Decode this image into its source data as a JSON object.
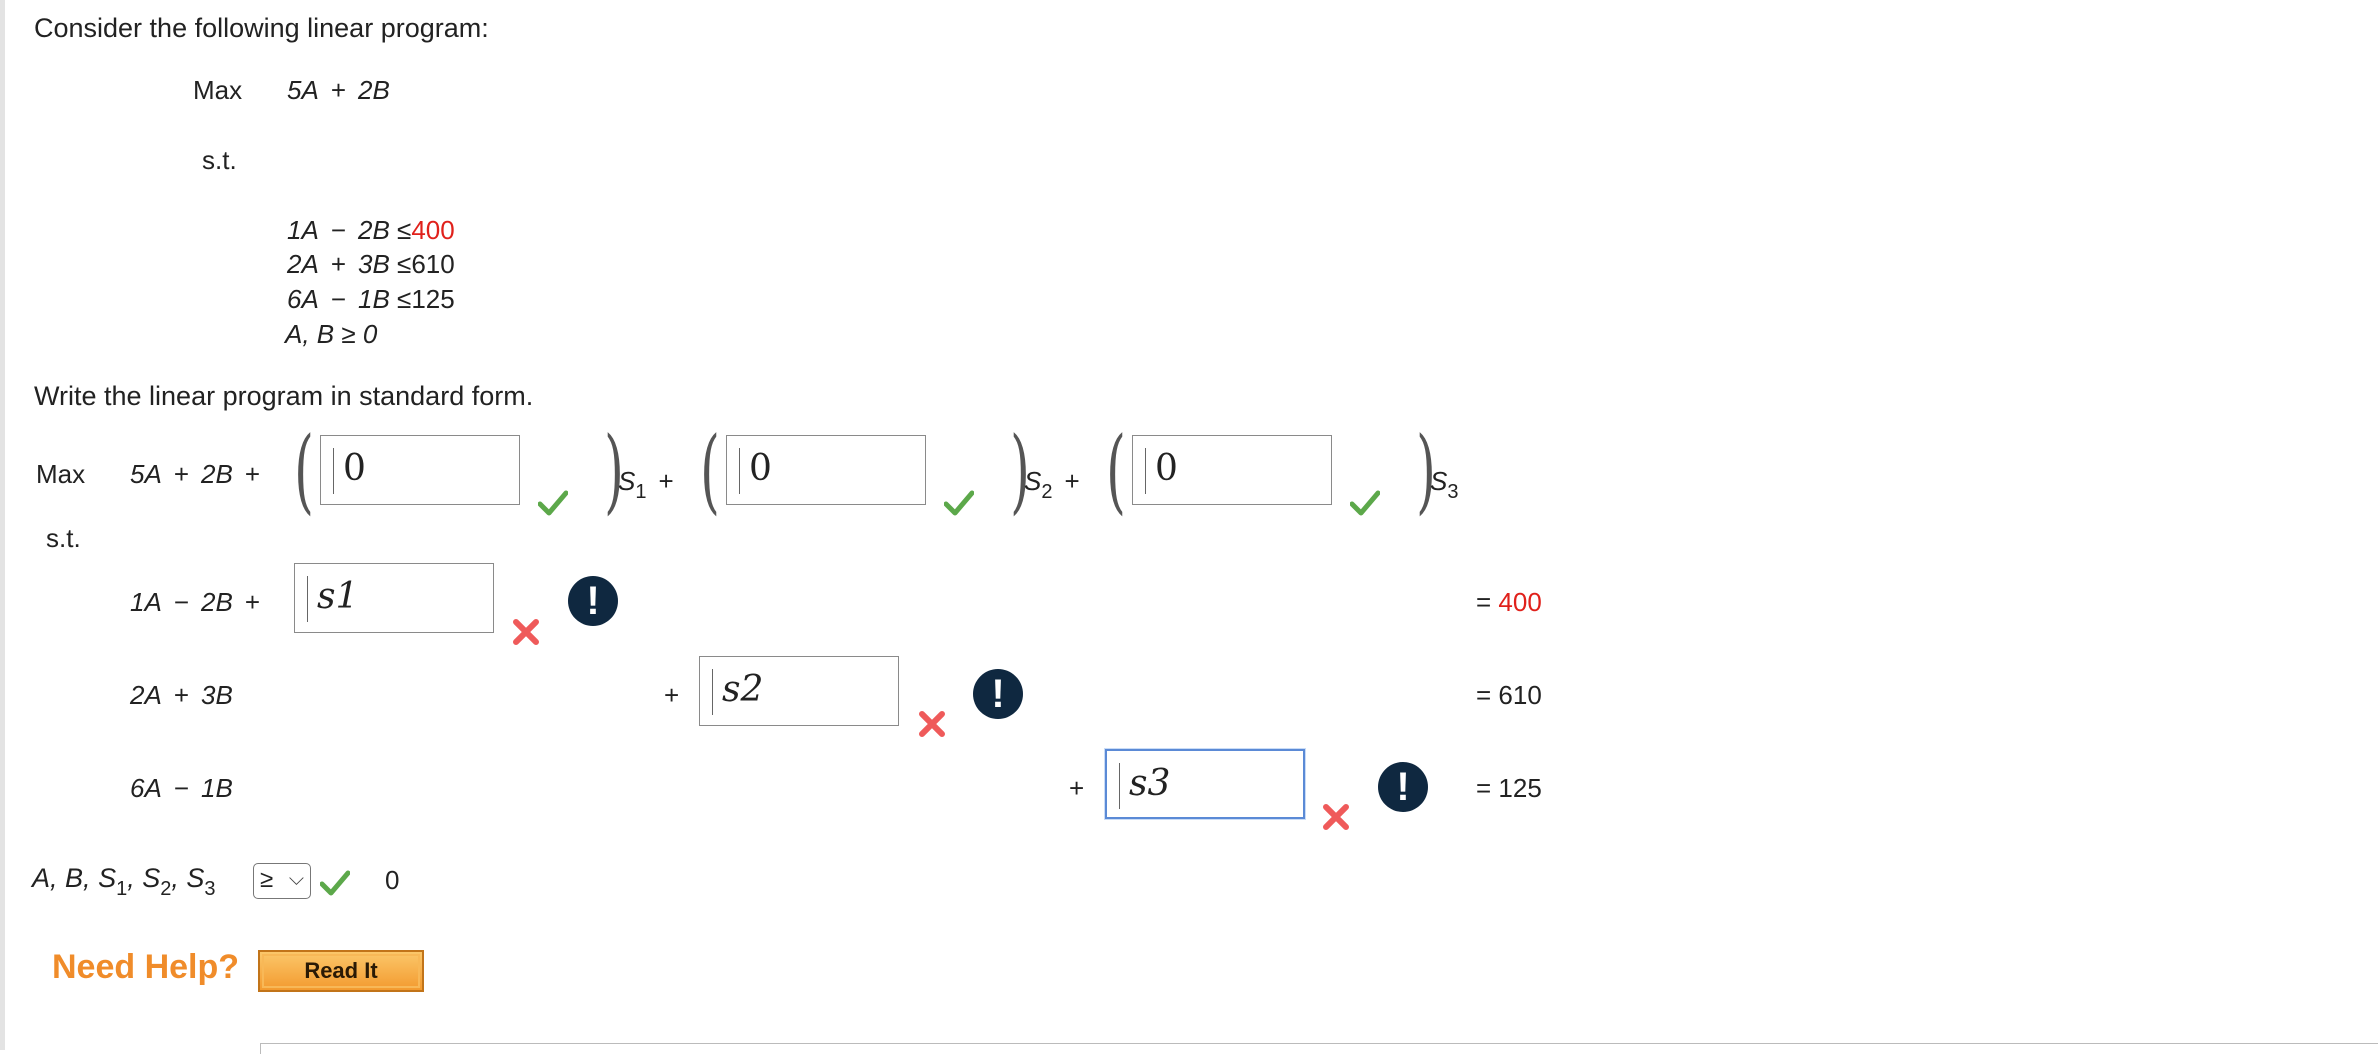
{
  "intro": "Consider the following linear program:",
  "lp": {
    "max_label": "Max",
    "objective": {
      "a_coef": "5A",
      "plus": "+",
      "b_coef": "2B"
    },
    "st_label": "s.t.",
    "constraints": [
      {
        "lhs1": "1A",
        "op": "−",
        "lhs2": "2B",
        "sym": "≤",
        "rhs": "400",
        "rhs_color": "#e0211b"
      },
      {
        "lhs1": "2A",
        "op": "+",
        "lhs2": "3B",
        "sym": "≤",
        "rhs": "610",
        "rhs_color": ""
      },
      {
        "lhs1": "6A",
        "op": "−",
        "lhs2": "1B",
        "sym": "≤",
        "rhs": "125",
        "rhs_color": ""
      }
    ],
    "nonneg": "A, B ≥ 0"
  },
  "prompt": "Write the linear program in standard form.",
  "standard": {
    "max_label": "Max",
    "objective_prefix": {
      "a": "5A",
      "plus1": "+",
      "b": "2B",
      "plus2": "+"
    },
    "slack_coef_inputs": [
      {
        "value": "0",
        "status": "correct",
        "var": "S",
        "sub": "1",
        "after": "+"
      },
      {
        "value": "0",
        "status": "correct",
        "var": "S",
        "sub": "2",
        "after": "+"
      },
      {
        "value": "0",
        "status": "correct",
        "var": "S",
        "sub": "3",
        "after": ""
      }
    ],
    "st_label": "s.t.",
    "rows": [
      {
        "lhs1": "1A",
        "op": "−",
        "lhs2": "2B",
        "plus": "+",
        "slack_value": "s1",
        "status": "incorrect",
        "eq": "=",
        "rhs": "400",
        "rhs_color": "#e0211b"
      },
      {
        "lhs1": "2A",
        "op": "+",
        "lhs2": "3B",
        "plus": "+",
        "slack_value": "s2",
        "status": "incorrect",
        "eq": "=",
        "rhs": "610",
        "rhs_color": ""
      },
      {
        "lhs1": "6A",
        "op": "−",
        "lhs2": "1B",
        "plus": "+",
        "slack_value": "s3",
        "status": "incorrect",
        "eq": "=",
        "rhs": "125",
        "rhs_color": ""
      }
    ],
    "alert_symbol": "!",
    "nonneg": {
      "vars": [
        "A",
        "B",
        "S",
        "S",
        "S"
      ],
      "subs": [
        "",
        "",
        "1",
        "2",
        "3"
      ],
      "select_value": "≥",
      "select_status": "correct",
      "rhs": "0"
    }
  },
  "help": {
    "label": "Need Help?",
    "button": "Read It"
  },
  "colors": {
    "correct": "#5ca84a",
    "incorrect": "#ef5a5a",
    "alert": "#0f2840",
    "accent": "#f08c2a"
  }
}
